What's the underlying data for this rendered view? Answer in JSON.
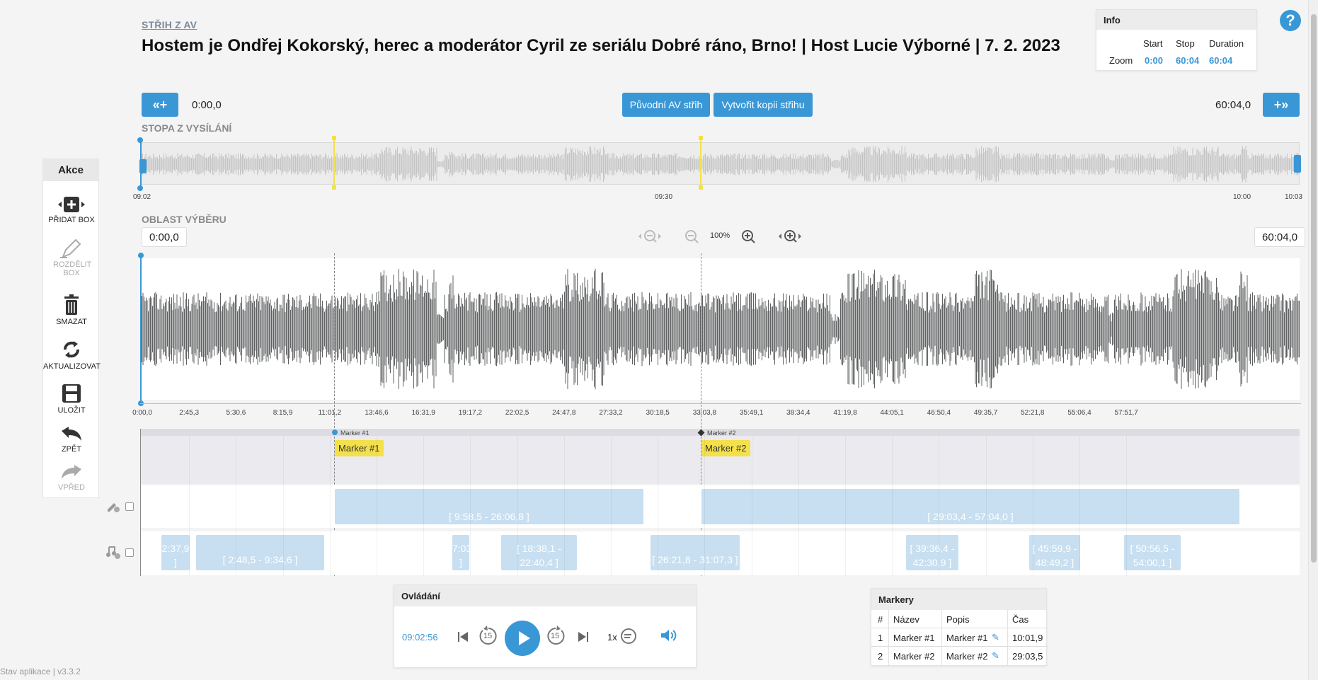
{
  "header": {
    "breadcrumb": "STŘIH Z AV",
    "title": "Hostem je Ondřej Kokorský, herec a moderátor Cyril ze seriálu Dobré ráno, Brno! | Host Lucie Výborné | 7. 2. 2023"
  },
  "info": {
    "title": "Info",
    "col_start": "Start",
    "col_stop": "Stop",
    "col_duration": "Duration",
    "row_label": "Zoom",
    "start": "0:00",
    "stop": "60:04",
    "duration": "60:04"
  },
  "help_icon": "?",
  "toolbar": {
    "left_btn": "«+",
    "right_btn": "+»",
    "left_time": "0:00,0",
    "right_time": "60:04,0",
    "original_btn": "Původní AV střih",
    "copy_btn": "Vytvořit kopii střihu"
  },
  "overview": {
    "label": "STOPA Z VYSÍLÁNÍ",
    "ticks": [
      "09:02",
      "09:30",
      "10:00",
      "10:03"
    ]
  },
  "selection": {
    "label": "OBLAST VÝBĚRU",
    "start_time": "0:00,0",
    "end_time": "60:04,0",
    "zoom_level": "100%",
    "ruler": [
      "0:00,0",
      "2:45,3",
      "5:30,6",
      "8:15,9",
      "11:01,2",
      "13:46,6",
      "16:31,9",
      "19:17,2",
      "22:02,5",
      "24:47,8",
      "27:33,2",
      "30:18,5",
      "33:03,8",
      "35:49,1",
      "38:34,4",
      "41:19,8",
      "44:05,1",
      "46:50,4",
      "49:35,7",
      "52:21,8",
      "55:06,4",
      "57:51,7"
    ]
  },
  "markers": [
    {
      "name": "Marker #1",
      "small": "Marker #1"
    },
    {
      "name": "Marker #2",
      "small": "Marker #2"
    }
  ],
  "lane_edit": {
    "boxes": [
      "[ 9:58,5 - 26:06,8 ]",
      "[ 29:03,4 - 57:04,0 ]"
    ]
  },
  "lane_music": {
    "boxes": [
      "2:37,9 ]",
      "[ 2:48,5 - 9:34,6 ]",
      "7:03 ]",
      "[ 18:38,1 - 22:40,4 ]",
      "[ 26:21,8 - 31:07,3 ]",
      "[ 39:36,4 - 42:30,9 ]",
      "[ 45:59,9 - 48:49,2 ]",
      "[ 50:56,5 - 54:00,1 ]"
    ]
  },
  "sidebar": {
    "title": "Akce",
    "items": [
      {
        "label": "PŘIDAT BOX",
        "icon": "add-box-icon"
      },
      {
        "label": "ROZDĚLIT BOX",
        "icon": "split-icon"
      },
      {
        "label": "SMAZAT",
        "icon": "trash-icon"
      },
      {
        "label": "AKTUALIZOVAT",
        "icon": "refresh-icon"
      },
      {
        "label": "ULOŽIT",
        "icon": "save-icon"
      },
      {
        "label": "ZPĚT",
        "icon": "undo-icon"
      },
      {
        "label": "VPŘED",
        "icon": "redo-icon"
      }
    ]
  },
  "controls": {
    "title": "Ovládání",
    "time": "09:02:56",
    "skip_back": "15",
    "skip_fwd": "15",
    "speed": "1x"
  },
  "markers_table": {
    "title": "Markery",
    "headers": [
      "#",
      "Název",
      "Popis",
      "Čas"
    ],
    "rows": [
      {
        "n": "1",
        "name": "Marker #1",
        "desc": "Marker #1",
        "time": "10:01,9"
      },
      {
        "n": "2",
        "name": "Marker #2",
        "desc": "Marker #2",
        "time": "29:03,5"
      }
    ]
  },
  "footer": "Stav aplikace | v3.3.2",
  "colors": {
    "accent": "#3a97d6",
    "marker": "#f3e04a",
    "box": "#c7dff0",
    "wave": "#5f6062"
  }
}
